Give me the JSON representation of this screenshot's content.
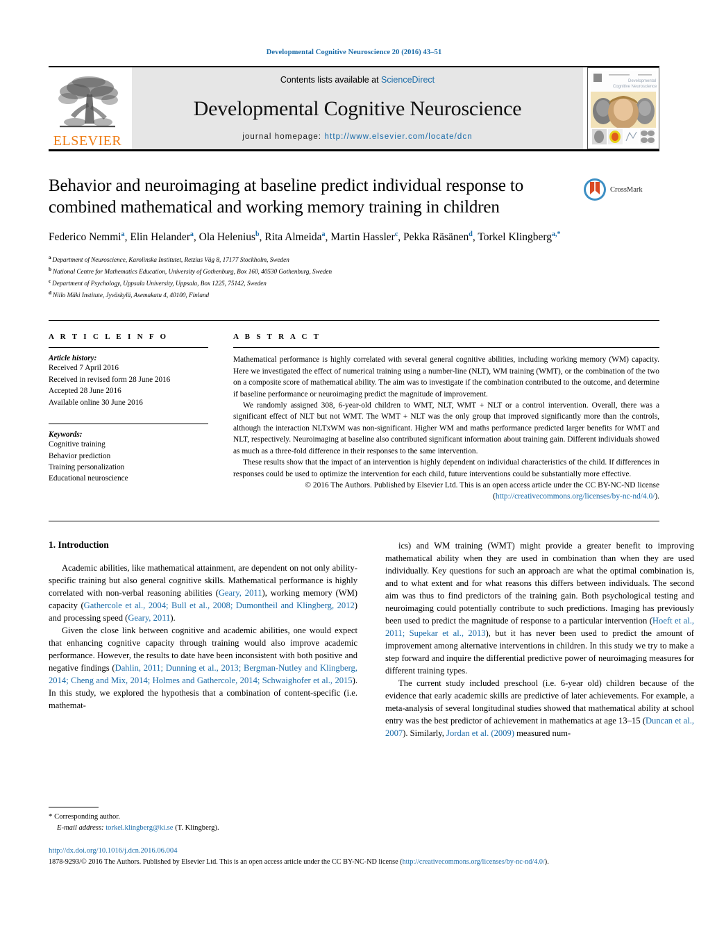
{
  "running_head": "Developmental Cognitive Neuroscience 20 (2016) 43–51",
  "banner": {
    "publisher_name": "ELSEVIER",
    "contents_prefix": "Contents lists available at ",
    "contents_link": "ScienceDirect",
    "journal_title": "Developmental Cognitive Neuroscience",
    "homepage_label": "journal homepage:",
    "homepage_url": "http://www.elsevier.com/locate/dcn",
    "cover_caption": "Developmental Cognitive Neuroscience"
  },
  "article": {
    "title": "Behavior and neuroimaging at baseline predict individual response to combined mathematical and working memory training in children",
    "crossmark_label": "CrossMark",
    "authors": [
      {
        "name": "Federico Nemmi",
        "sup": "a"
      },
      {
        "name": "Elin Helander",
        "sup": "a"
      },
      {
        "name": "Ola Helenius",
        "sup": "b"
      },
      {
        "name": "Rita Almeida",
        "sup": "a"
      },
      {
        "name": "Martin Hassler",
        "sup": "c"
      },
      {
        "name": "Pekka Räsänen",
        "sup": "d"
      },
      {
        "name": "Torkel Klingberg",
        "sup": "a,*"
      }
    ],
    "affiliations": [
      {
        "mark": "a",
        "text": "Department of Neuroscience, Karolinska Institutet, Retzius Väg 8, 17177 Stockholm, Sweden"
      },
      {
        "mark": "b",
        "text": "National Centre for Mathematics Education, University of Gothenburg, Box 160, 40530 Gothenburg, Sweden"
      },
      {
        "mark": "c",
        "text": "Department of Psychology, Uppsala University, Uppsala, Box 1225, 75142, Sweden"
      },
      {
        "mark": "d",
        "text": "Niilo Mäki Institute, Jyväskylä, Asemakatu 4, 40100, Finland"
      }
    ]
  },
  "article_info": {
    "heading": "A R T I C L E   I N F O",
    "history_title": "Article history:",
    "history": [
      "Received 7 April 2016",
      "Received in revised form 28 June 2016",
      "Accepted 28 June 2016",
      "Available online 30 June 2016"
    ],
    "keywords_title": "Keywords:",
    "keywords": [
      "Cognitive training",
      "Behavior prediction",
      "Training personalization",
      "Educational neuroscience"
    ]
  },
  "abstract": {
    "heading": "A B S T R A C T",
    "paragraphs": [
      "Mathematical performance is highly correlated with several general cognitive abilities, including working memory (WM) capacity. Here we investigated the effect of numerical training using a number-line (NLT), WM training (WMT), or the combination of the two on a composite score of mathematical ability. The aim was to investigate if the combination contributed to the outcome, and determine if baseline performance or neuroimaging predict the magnitude of improvement.",
      "We randomly assigned 308, 6-year-old children to WMT, NLT, WMT + NLT or a control intervention. Overall, there was a significant effect of NLT but not WMT. The WMT + NLT was the only group that improved significantly more than the controls, although the interaction NLTxWM was non-significant. Higher WM and maths performance predicted larger benefits for WMT and NLT, respectively. Neuroimaging at baseline also contributed significant information about training gain. Different individuals showed as much as a three-fold difference in their responses to the same intervention.",
      "These results show that the impact of an intervention is highly dependent on individual characteristics of the child. If differences in responses could be used to optimize the intervention for each child, future interventions could be substantially more effective."
    ],
    "copyright": "© 2016 The Authors. Published by Elsevier Ltd. This is an open access article under the CC BY-NC-ND",
    "license_prefix": "license (",
    "license_url": "http://creativecommons.org/licenses/by-nc-nd/4.0/",
    "license_suffix": ")."
  },
  "introduction": {
    "section_title": "1.  Introduction",
    "left_paragraphs": [
      {
        "segments": [
          {
            "t": "Academic abilities, like mathematical attainment, are dependent on not only ability-specific training but also general cognitive skills. Mathematical performance is highly correlated with non-verbal reasoning abilities (",
            "link": false
          },
          {
            "t": "Geary, 2011",
            "link": true
          },
          {
            "t": "), working memory (WM) capacity (",
            "link": false
          },
          {
            "t": "Gathercole et al., 2004; Bull et al., 2008; Dumontheil and Klingberg, 2012",
            "link": true
          },
          {
            "t": ") and processing speed (",
            "link": false
          },
          {
            "t": "Geary, 2011",
            "link": true
          },
          {
            "t": ").",
            "link": false
          }
        ]
      },
      {
        "segments": [
          {
            "t": "Given the close link between cognitive and academic abilities, one would expect that enhancing cognitive capacity through training would also improve academic performance. However, the results to date have been inconsistent with both positive and negative findings (",
            "link": false
          },
          {
            "t": "Dahlin, 2011; Dunning et al., 2013; Bergman-Nutley and Klingberg, 2014; Cheng and Mix, 2014; Holmes and Gathercole, 2014; Schwaighofer et al., 2015",
            "link": true
          },
          {
            "t": "). In this study, we explored the hypothesis that a combination of content-specific (i.e. mathemat-",
            "link": false
          }
        ]
      }
    ],
    "right_paragraphs": [
      {
        "segments": [
          {
            "t": "ics) and WM training (WMT) might provide a greater benefit to improving mathematical ability when they are used in combination than when they are used individually. Key questions for such an approach are what the optimal combination is, and to what extent and for what reasons this differs between individuals. The second aim was thus to find predictors of the training gain. Both psychological testing and neuroimaging could potentially contribute to such predictions. Imaging has previously been used to predict the magnitude of response to a particular intervention (",
            "link": false
          },
          {
            "t": "Hoeft et al., 2011; Supekar et al., 2013",
            "link": true
          },
          {
            "t": "), but it has never been used to predict the amount of improvement among alternative interventions in children. In this study we try to make a step forward and inquire the differential predictive power of neuroimaging measures for different training types.",
            "link": false
          }
        ]
      },
      {
        "segments": [
          {
            "t": "The current study included preschool (i.e. 6-year old) children because of the evidence that early academic skills are predictive of later achievements. For example, a meta-analysis of several longitudinal studies showed that mathematical ability at school entry was the best predictor of achievement in mathematics at age 13–15 (",
            "link": false
          },
          {
            "t": "Duncan et al., 2007",
            "link": true
          },
          {
            "t": "). Similarly, ",
            "link": false
          },
          {
            "t": "Jordan et al. (2009)",
            "link": true
          },
          {
            "t": " measured num-",
            "link": false
          }
        ]
      }
    ]
  },
  "footnote": {
    "star": "*",
    "corresponding": " Corresponding author.",
    "email_label": "E-mail address:",
    "email": "torkel.klingberg@ki.se",
    "email_owner": "(T. Klingberg)."
  },
  "footer": {
    "doi": "http://dx.doi.org/10.1016/j.dcn.2016.06.004",
    "issn_prefix": "1878-9293/© 2016 The Authors. Published by Elsevier Ltd. This is an open access article under the CC BY-NC-ND license (",
    "license_url": "http://creativecommons.org/licenses/by-nc-nd/4.0/",
    "issn_suffix": ")."
  },
  "colors": {
    "link": "#1a6ba8",
    "elsevier_orange": "#ef7d16",
    "banner_grey": "#e6e6e6"
  }
}
